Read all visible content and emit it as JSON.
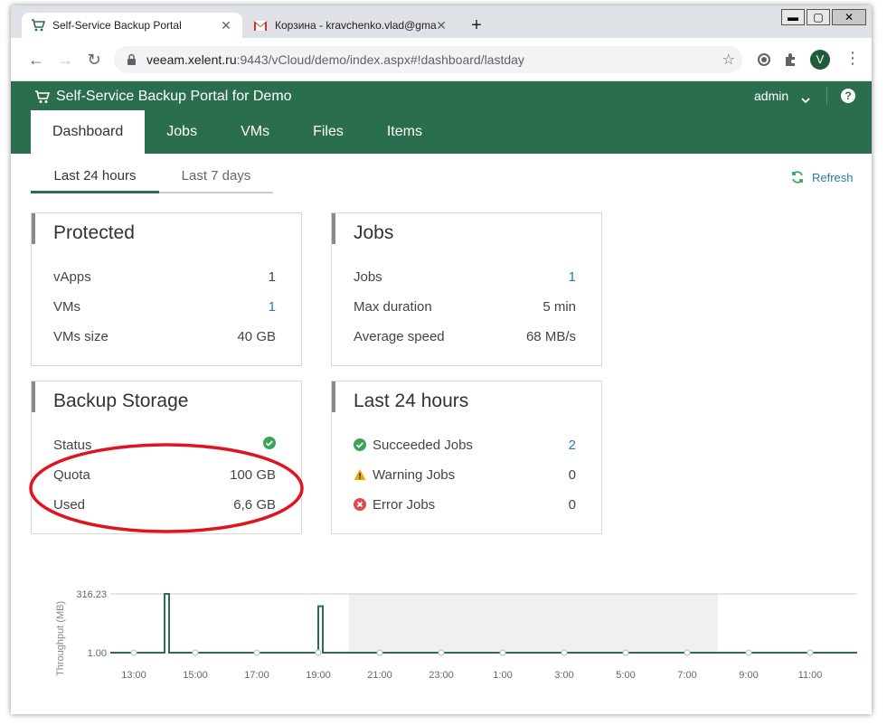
{
  "browser": {
    "tabs": [
      {
        "title": "Self-Service Backup Portal",
        "active": true
      },
      {
        "title": "Корзина - kravchenko.vlad@gma",
        "active": false
      }
    ],
    "url_host": "veeam.xelent.ru",
    "url_rest": ":9443/vCloud/demo/index.aspx#!dashboard/lastday",
    "profile_initial": "V",
    "window_controls": {
      "minimize": "▬",
      "restore": "▢",
      "close": "✕"
    }
  },
  "app": {
    "title": "Self-Service Backup Portal for Demo",
    "user": "admin",
    "help": "?",
    "nav": [
      {
        "label": "Dashboard",
        "active": true
      },
      {
        "label": "Jobs"
      },
      {
        "label": "VMs"
      },
      {
        "label": "Files"
      },
      {
        "label": "Items"
      }
    ],
    "subtabs": [
      {
        "label": "Last 24 hours",
        "active": true
      },
      {
        "label": "Last 7 days"
      }
    ],
    "refresh_label": "Refresh",
    "accent_color": "#2b6e4f",
    "link_color": "#2a7ab0"
  },
  "cards": {
    "protected": {
      "title": "Protected",
      "rows": [
        {
          "label": "vApps",
          "value": "1"
        },
        {
          "label": "VMs",
          "value": "1"
        },
        {
          "label": "VMs size",
          "value": "40 GB"
        }
      ]
    },
    "jobs": {
      "title": "Jobs",
      "rows": [
        {
          "label": "Jobs",
          "value": "1"
        },
        {
          "label": "Max duration",
          "value": "5 min"
        },
        {
          "label": "Average speed",
          "value": "68 MB/s"
        }
      ]
    },
    "storage": {
      "title": "Backup Storage",
      "rows": [
        {
          "label": "Status",
          "value": "ok",
          "icon": "check-circle-icon"
        },
        {
          "label": "Quota",
          "value": "100 GB"
        },
        {
          "label": "Used",
          "value": "6,6 GB"
        }
      ]
    },
    "last24": {
      "title": "Last 24 hours",
      "rows": [
        {
          "label": "Succeeded Jobs",
          "value": "2",
          "icon": "success-icon"
        },
        {
          "label": "Warning Jobs",
          "value": "0",
          "icon": "warning-icon"
        },
        {
          "label": "Error Jobs",
          "value": "0",
          "icon": "error-icon"
        }
      ]
    }
  },
  "chart_data": {
    "type": "line",
    "ylabel": "Throughput (MB)",
    "yticks": [
      "316.23",
      "1.00"
    ],
    "xticks": [
      "13:00",
      "15:00",
      "17:00",
      "19:00",
      "21:00",
      "23:00",
      "1:00",
      "3:00",
      "5:00",
      "7:00",
      "9:00",
      "11:00"
    ],
    "spikes": [
      {
        "x": "14:00",
        "y": 316.23
      },
      {
        "x": "19:00",
        "y": 250
      }
    ],
    "baseline": 1.0,
    "shaded_range": [
      "20:00",
      "8:00"
    ],
    "line_color": "#2b6e4f"
  }
}
